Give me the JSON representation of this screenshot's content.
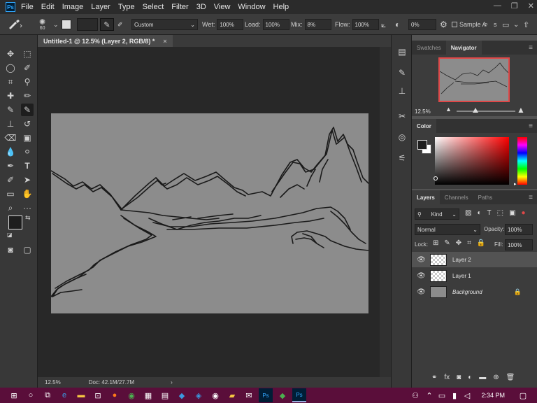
{
  "app": {
    "logo": "Ps"
  },
  "menu": [
    "File",
    "Edit",
    "Image",
    "Layer",
    "Type",
    "Select",
    "Filter",
    "3D",
    "View",
    "Window",
    "Help"
  ],
  "window_controls": [
    "—",
    "❐",
    "✕"
  ],
  "options": {
    "brush_size": "60",
    "preset": "Custom",
    "wet_label": "Wet:",
    "wet_value": "100%",
    "load_label": "Load:",
    "load_value": "100%",
    "mix_label": "Mix:",
    "mix_value": "8%",
    "flow_label": "Flow:",
    "flow_value": "100%",
    "smoothing_value": "0%",
    "sample_label": "Sample A"
  },
  "document": {
    "tab_title": "Untitled-1 @ 12.5% (Layer 2, RGB/8) *",
    "close": "×"
  },
  "status": {
    "zoom": "12.5%",
    "doc": "Doc: 42.1M/27.7M",
    "arrow": "›"
  },
  "navigator": {
    "tabs": [
      "Swatches",
      "Navigator"
    ],
    "zoom": "12.5%"
  },
  "color_panel": {
    "tab": "Color",
    "hue_color": "#ff0000"
  },
  "layers_panel": {
    "tabs": [
      "Layers",
      "Channels",
      "Paths"
    ],
    "filter_kind": "Kind",
    "blend_mode": "Normal",
    "opacity_label": "Opacity:",
    "opacity_value": "100%",
    "lock_label": "Lock:",
    "fill_label": "Fill:",
    "fill_value": "100%",
    "layers": [
      {
        "name": "Layer 2",
        "selected": true
      },
      {
        "name": "Layer 1",
        "selected": false
      },
      {
        "name": "Background",
        "selected": false
      }
    ]
  },
  "taskbar": {
    "time": "2:34 PM",
    "accent": "#5a0e3a"
  },
  "colors": {
    "canvas": "#8c8c8c",
    "panel": "#3c3c3c",
    "workspace": "#282828"
  }
}
